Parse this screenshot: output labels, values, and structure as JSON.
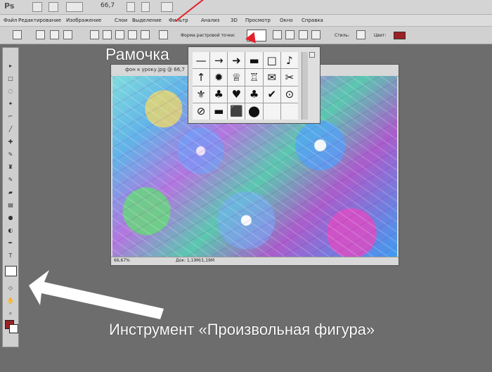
{
  "app": {
    "logo": "Ps",
    "zoom": "66,7"
  },
  "menu": [
    "Файл",
    "Редактирование",
    "Изображение",
    "Слои",
    "Выделение",
    "Фильтр",
    "Анализ",
    "3D",
    "Просмотр",
    "Окно",
    "Справка"
  ],
  "options": {
    "shape_label": "Форма растровой точки:",
    "style_label": "Стиль:",
    "color_label": "Цвет:",
    "color": "#9b2222"
  },
  "document": {
    "title": "фон к уроку.jpg @ 66,7",
    "zoom": "66,67%",
    "info": "Док: 1,19M/1,19M"
  },
  "shapes": [
    "—",
    "→",
    "➜",
    "▬",
    "□",
    "♪",
    "↑",
    "✹",
    "♕",
    "♖",
    "✉",
    "✂",
    "⚜",
    "♣",
    "♥",
    "♣",
    "✔",
    "⊙",
    "⊘",
    "▬",
    "⬛",
    "⬤"
  ],
  "annotations": {
    "frame": "Рамочка",
    "tool": "Инструмент «Произвольная фигура»"
  }
}
